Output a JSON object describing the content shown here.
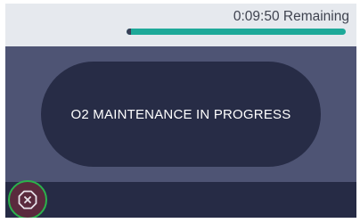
{
  "header": {
    "remaining_text": "0:09:50 Remaining",
    "progress": {
      "elapsed_fraction": 0.02
    }
  },
  "status": {
    "message": "O2 MAINTENANCE IN PROGRESS"
  },
  "cancel": {
    "icon": "cancel-octagon-icon"
  },
  "colors": {
    "accent": "#1ea999",
    "panel": "#4e5474",
    "pill": "#272c46",
    "cancel_border": "#2bb24c",
    "cancel_bg": "#5a2a3d"
  }
}
